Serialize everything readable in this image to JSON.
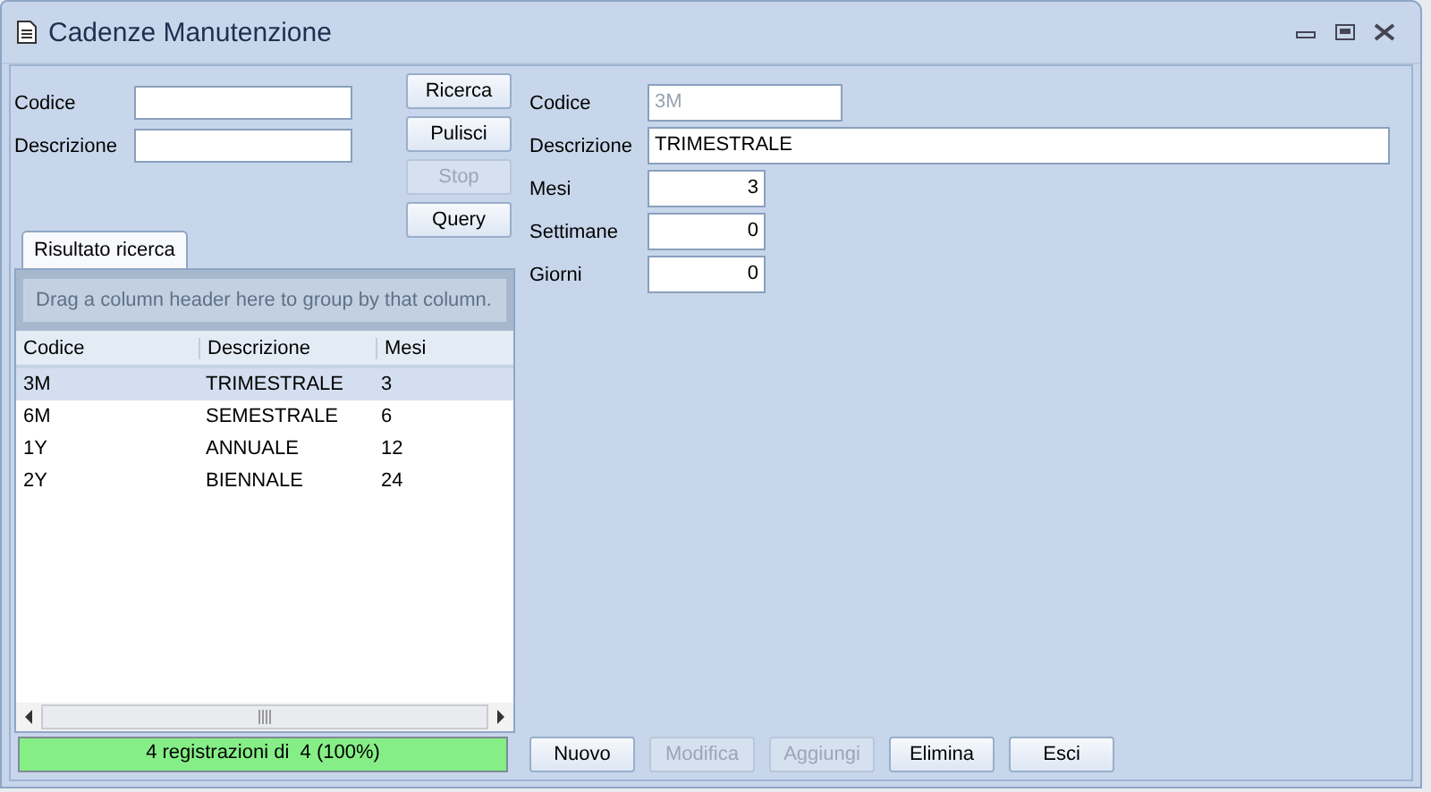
{
  "window": {
    "title": "Cadenze Manutenzione"
  },
  "search": {
    "fields": [
      {
        "label": "Codice"
      },
      {
        "label": "Descrizione"
      }
    ],
    "buttons": [
      {
        "label": "Ricerca",
        "disabled": false
      },
      {
        "label": "Pulisci",
        "disabled": false
      },
      {
        "label": "Stop",
        "disabled": true
      },
      {
        "label": "Query",
        "disabled": false
      }
    ]
  },
  "tabs": [
    {
      "label": "Risultato ricerca",
      "selected": true
    }
  ],
  "grid": {
    "group_hint": "Drag a column header here to group by that column.",
    "columns": [
      "Codice",
      "Descrizione",
      "Mesi"
    ],
    "rows": [
      {
        "cells": [
          "3M",
          "TRIMESTRALE",
          "3"
        ],
        "selected": true
      },
      {
        "cells": [
          "6M",
          "SEMESTRALE",
          "6"
        ],
        "selected": false
      },
      {
        "cells": [
          "1Y",
          "ANNUALE",
          "12"
        ],
        "selected": false
      },
      {
        "cells": [
          "2Y",
          "BIENNALE",
          "24"
        ],
        "selected": false
      }
    ]
  },
  "status_bar": {
    "text": "4 registrazioni di  4 (100%)",
    "level": 1
  },
  "detail": {
    "fields": [
      {
        "label": "Codice",
        "value": "3M",
        "kind": "code",
        "disabled": true
      },
      {
        "label": "Descrizione",
        "value": "TRIMESTRALE",
        "kind": "wide",
        "disabled": false
      },
      {
        "label": "Mesi",
        "value": "3",
        "kind": "number",
        "disabled": false
      },
      {
        "label": "Settimane",
        "value": "0",
        "kind": "number",
        "disabled": false
      },
      {
        "label": "Giorni",
        "value": "0",
        "kind": "number",
        "disabled": false
      }
    ]
  },
  "actions": [
    {
      "label": "Nuovo",
      "disabled": false
    },
    {
      "label": "Modifica",
      "disabled": true
    },
    {
      "label": "Aggiungi",
      "disabled": true
    },
    {
      "label": "Elimina",
      "disabled": false
    },
    {
      "label": "Esci",
      "disabled": false
    }
  ]
}
